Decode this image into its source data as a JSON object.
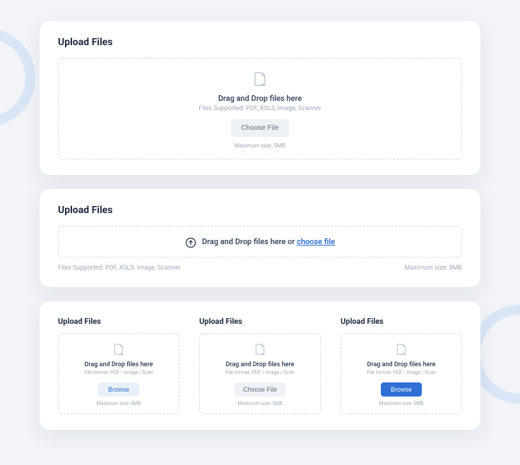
{
  "card1": {
    "title": "Upload Files",
    "drag_text": "Drag and Drop files here",
    "supported": "Files Supported: PDF, XSLS, Image, Scanner",
    "button": "Choose File",
    "max": "Maximum size: 5MB"
  },
  "card2": {
    "title": "Upload Files",
    "drag_text": "Drag and Drop files here or ",
    "link": "choose file",
    "supported": "Files Supported: PDF, XSLS, Image, Scanner",
    "max": "Maximum size: 5MB"
  },
  "card3": {
    "items": [
      {
        "title": "Upload Files",
        "drag_text": "Drag and Drop files here",
        "supported": "File format: PDF / Image / Scan",
        "button": "Browse",
        "max": "Maximum size: 5MB"
      },
      {
        "title": "Upload Files",
        "drag_text": "Drag and Drop files here",
        "supported": "File format: PDF / Image / Scan",
        "button": "Choose File",
        "max": "Maximum size: 5MB"
      },
      {
        "title": "Upload Files",
        "drag_text": "Drag and Drop files here",
        "supported": "File format: PDF / Image / Scan",
        "button": "Browse",
        "max": "Maximum size: 5MB"
      }
    ]
  }
}
